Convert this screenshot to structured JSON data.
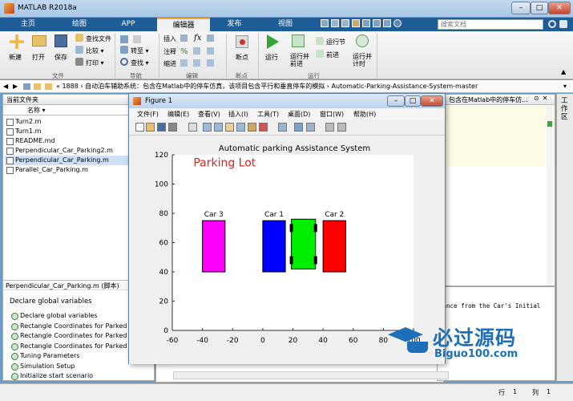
{
  "window": {
    "title": "MATLAB R2018a",
    "min": "–",
    "max": "□",
    "close": "✕"
  },
  "tabs": [
    "主页",
    "绘图",
    "APP",
    "编辑器",
    "发布",
    "视图"
  ],
  "active_tab": "编辑器",
  "search": {
    "placeholder": "搜索文档"
  },
  "ribbon": {
    "file": {
      "new": "新建",
      "open": "打开",
      "save": "保存",
      "find_file": "查找文件",
      "compare": "比较",
      "print": "打印",
      "group": "文件"
    },
    "nav": {
      "goto": "转至",
      "find": "查找",
      "group": "导航"
    },
    "edit": {
      "insert": "插入",
      "comment": "注释",
      "indent": "缩进",
      "fx": "fx",
      "group": "编辑"
    },
    "breakpoint": {
      "label": "断点",
      "group": "断点"
    },
    "run": {
      "run": "运行",
      "run_advance": "运行并\n前进",
      "run_section": "运行节",
      "advance": "前进",
      "run_time": "运行并\n计时",
      "group": "运行"
    }
  },
  "address": {
    "path": "«  1888  ›  自动泊车辅助系统：包含在Matlab中的停车仿真，该项目包含平行和垂直停车的模拟  ›  Automatic-Parking-Assistance-System-master"
  },
  "left_panel": {
    "title": "当前文件夹",
    "col_name": "名称 ▾",
    "files": [
      "Turn2.m",
      "Turn1.m",
      "README.md",
      "Perpendicular_Car_Parking2.m",
      "Perpendicular_Car_Parking.m",
      "Parallel_Car_Parking.m"
    ],
    "selected": "Perpendicular_Car_Parking.m",
    "details_title": "Perpendicular_Car_Parking.m  (脚本)",
    "details_desc": "Declare global variables",
    "sections": [
      "Declare global variables",
      "Rectangle Coordinates for Parked",
      "Rectangle Coordinates for Parked",
      "Rectangle Coordinates for Parked",
      "Tuning Parameters",
      "Simulation Setup",
      "Initialize start scenario"
    ]
  },
  "right_panel": {
    "crumb": "包含在Matlab中的停车仿..."
  },
  "cmd_panel": {
    "text": "tance from the Car's Initial"
  },
  "side_tab": "工作区",
  "status": {
    "row_label": "行",
    "row": "1",
    "col_label": "列",
    "col": "1"
  },
  "figure": {
    "title": "Figure 1",
    "menu": [
      "文件(F)",
      "编辑(E)",
      "查看(V)",
      "插入(I)",
      "工具(T)",
      "桌面(D)",
      "窗口(W)",
      "帮助(H)"
    ]
  },
  "logo": {
    "main": "必过源码",
    "sub": "Biguo100.com"
  },
  "chart_data": {
    "type": "bar",
    "title": "Automatic parking Assistance System",
    "annotation": "Parking Lot",
    "annotation_color": "#e02020",
    "xlim": [
      -60,
      100
    ],
    "ylim": [
      0,
      120
    ],
    "xticks": [
      -60,
      -40,
      -20,
      0,
      20,
      40,
      60,
      80,
      100
    ],
    "yticks": [
      0,
      20,
      40,
      60,
      80,
      100,
      120
    ],
    "cars": [
      {
        "name": "Car 3",
        "x0": -40,
        "x1": -25,
        "y0": 40,
        "y1": 75,
        "color": "#ff00ff"
      },
      {
        "name": "Car 1",
        "x0": 0,
        "x1": 15,
        "y0": 40,
        "y1": 75,
        "color": "#0000ff"
      },
      {
        "name": "",
        "x0": 19,
        "x1": 35,
        "y0": 42,
        "y1": 76,
        "color": "#00ee00",
        "wheels": true
      },
      {
        "name": "Car 2",
        "x0": 40,
        "x1": 55,
        "y0": 40,
        "y1": 75,
        "color": "#ff0000"
      }
    ]
  }
}
